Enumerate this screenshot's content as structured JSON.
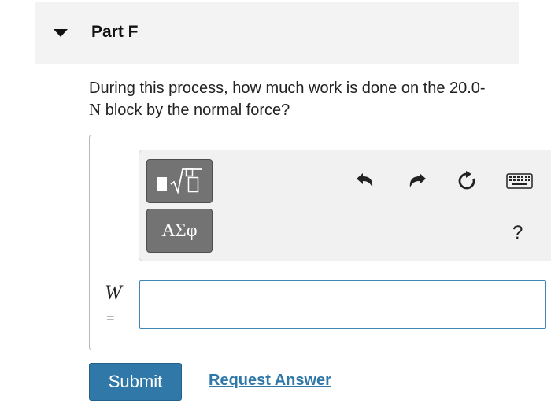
{
  "part": {
    "title": "Part F"
  },
  "question": {
    "text_line1": "During this process, how much work is done on the 20.0-",
    "unit": "N",
    "text_line2": " block by the normal force?"
  },
  "toolbar": {
    "templates_icon": "fraction-root-template-icon",
    "greek_label": "ΑΣφ",
    "undo_icon": "undo-icon",
    "redo_icon": "redo-icon",
    "reset_icon": "reset-icon",
    "keyboard_icon": "keyboard-icon",
    "help_label": "?"
  },
  "answer": {
    "variable": "W",
    "equals": "=",
    "value": ""
  },
  "actions": {
    "submit_label": "Submit",
    "request_label": "Request Answer"
  },
  "colors": {
    "accent": "#2f78a8",
    "toolbar_button": "#737373"
  }
}
